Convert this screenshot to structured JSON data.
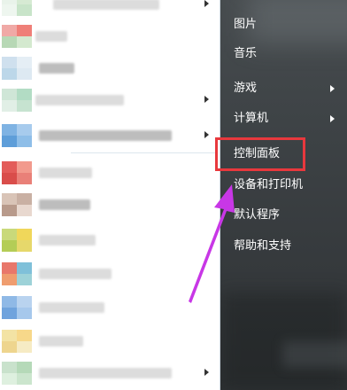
{
  "start_menu": {
    "right_items": [
      {
        "label": "图片"
      },
      {
        "label": "音乐"
      },
      {
        "label": "游戏"
      },
      {
        "label": "计算机"
      },
      {
        "label": "控制面板"
      },
      {
        "label": "设备和打印机"
      },
      {
        "label": "默认程序"
      },
      {
        "label": "帮助和支持"
      }
    ],
    "colors": {
      "highlight": "#e8383d",
      "pointer_arrow": "#c837e6",
      "right_pane": "#3d4245"
    }
  }
}
